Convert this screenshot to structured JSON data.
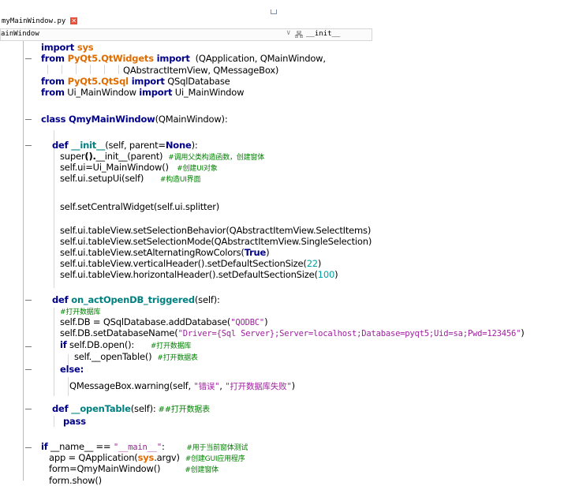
{
  "tab": {
    "filename": "myMainWindow.py",
    "close_glyph": "✕"
  },
  "navbar": {
    "class_selector": "ainWindow",
    "method_selector": "__init__",
    "chevron": "∨"
  },
  "code": {
    "l1": [
      "import",
      " sys"
    ],
    "l2": [
      "from",
      " PyQt5.QtWidgets",
      " import",
      "  (QApplication, QMainWindow,"
    ],
    "l3": [
      "QAbstractItemView, QMessageBox)"
    ],
    "l4": [
      "from",
      " PyQt5.QtSql",
      " import",
      " QSqlDatabase"
    ],
    "l5": [
      "from",
      " Ui_MainWindow ",
      "import",
      " Ui_MainWindow"
    ],
    "l6": [
      "class",
      " QmyMainWindow",
      "(QMainWindow):"
    ],
    "l7": [
      "def",
      " __init__",
      "(self, parent=",
      "None",
      "):"
    ],
    "l8": [
      "super",
      "().",
      "__init__",
      "(parent)  ",
      "#调用父类构造函数，创建窗体"
    ],
    "l9": [
      "self.ui=Ui_MainWindow()",
      "   ",
      "#创建UI对象"
    ],
    "l10": [
      "self.ui.setupUi(self)",
      "      ",
      "#构造UI界面"
    ],
    "l11": [
      "self.setCentralWidget(self.ui.splitter)"
    ],
    "l12": [
      "self.ui.tableView.setSelectionBehavior(QAbstractItemView.SelectItems)"
    ],
    "l13": [
      "self.ui.tableView.setSelectionMode(QAbstractItemView.SingleSelection)"
    ],
    "l14": [
      "self.ui.tableView.setAlternatingRowColors(",
      "True",
      ")"
    ],
    "l15": [
      "self.ui.tableView.verticalHeader().setDefaultSectionSize(",
      "22",
      ")"
    ],
    "l16": [
      "self.ui.tableView.horizontalHeader().setDefaultSectionSize(",
      "100",
      ")"
    ],
    "l17": [
      "def",
      " on_actOpenDB_triggered",
      "(self):"
    ],
    "l18": [
      "#打开数据库"
    ],
    "l19": [
      "self.DB = QSqlDatabase.addDatabase(",
      "\"QODBC\"",
      ")"
    ],
    "l20": [
      "self.DB.setDatabaseName(",
      "\"Driver={Sql Server};Server=localhost;Database=pyqt5;Uid=sa;Pwd=123456\"",
      ")"
    ],
    "l21": [
      "if",
      " self.DB.open():",
      "      ",
      "#打开数据库"
    ],
    "l22": [
      "self.__openTable()",
      "  ",
      "#打开数据表"
    ],
    "l23": [
      "else:"
    ],
    "l24": [
      "QMessageBox.warning(self, ",
      "\"错误\"",
      ", ",
      "\"打开数据库失败\"",
      ")"
    ],
    "l25": [
      "def",
      " __openTable",
      "(self):",
      " ##打开数据表"
    ],
    "l26": [
      "pass"
    ],
    "l27": [
      "if",
      " __name__ == ",
      "\"__main__\"",
      ":",
      "        ",
      "#用于当前窗体测试"
    ],
    "l28": [
      "app = QApplication(",
      "sys",
      ".argv)",
      "  ",
      "#创建GUI应用程序"
    ],
    "l29": [
      "form=QmyMainWindow()",
      "         ",
      "#创建窗体"
    ],
    "l30": [
      "form.show()"
    ]
  }
}
